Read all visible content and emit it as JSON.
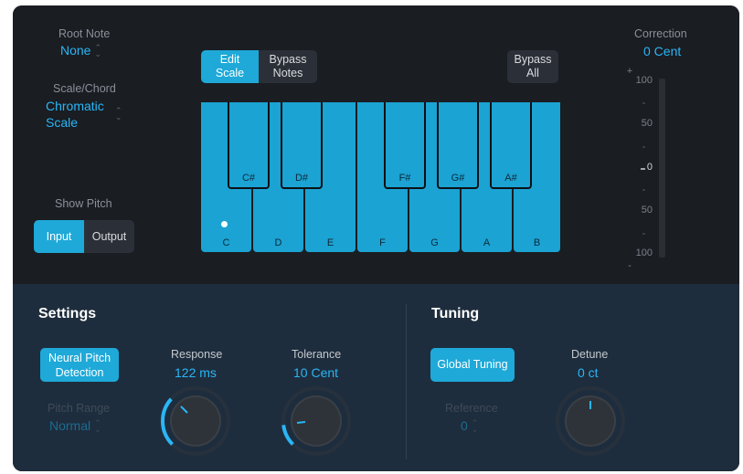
{
  "root_note": {
    "label": "Root Note",
    "value": "None"
  },
  "scale_chord": {
    "label": "Scale/Chord",
    "value_line1": "Chromatic",
    "value_line2": "Scale"
  },
  "show_pitch": {
    "label": "Show Pitch",
    "input": "Input",
    "output": "Output",
    "selected": "Input"
  },
  "keyboard_buttons": {
    "edit_scale_1": "Edit",
    "edit_scale_2": "Scale",
    "bypass_notes_1": "Bypass",
    "bypass_notes_2": "Notes",
    "bypass_all_1": "Bypass",
    "bypass_all_2": "All"
  },
  "keyboard": {
    "white_keys": [
      "C",
      "D",
      "E",
      "F",
      "G",
      "A",
      "B"
    ],
    "black_keys": [
      "C#",
      "D#",
      "F#",
      "G#",
      "A#"
    ],
    "active_note": "C"
  },
  "correction": {
    "label": "Correction",
    "value": "0 Cent",
    "scale": [
      "+",
      "100",
      "50",
      "0",
      "50",
      "100",
      "-"
    ]
  },
  "settings": {
    "title": "Settings",
    "neural_1": "Neural Pitch",
    "neural_2": "Detection",
    "pitch_range_label": "Pitch Range",
    "pitch_range_value": "Normal",
    "response_label": "Response",
    "response_value": "122 ms",
    "tolerance_label": "Tolerance",
    "tolerance_value": "10 Cent"
  },
  "tuning": {
    "title": "Tuning",
    "global_tuning": "Global Tuning",
    "reference_label": "Reference",
    "reference_value": "0",
    "detune_label": "Detune",
    "detune_value": "0 ct"
  },
  "colors": {
    "accent": "#29b6f6",
    "key": "#1ba3d3",
    "panel": "#1e2d3d",
    "background": "#1a1d22"
  }
}
